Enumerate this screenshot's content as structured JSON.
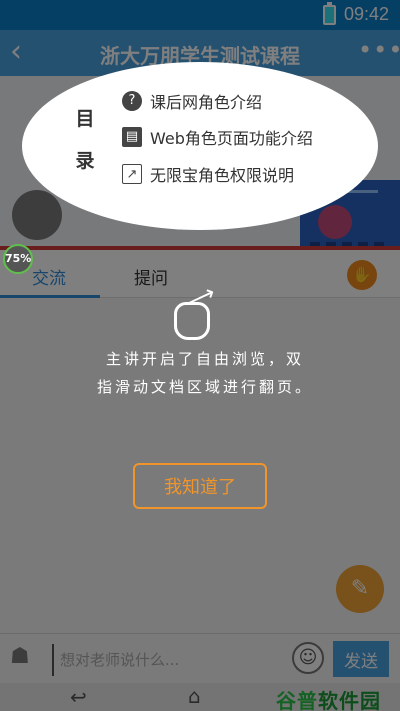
{
  "status_bar": {
    "time": "09:42",
    "battery_icon": "battery-icon"
  },
  "title_bar": {
    "back_icon": "‹",
    "title": "浙大万朋学生测试课程",
    "more_icon": "•••"
  },
  "menu": {
    "heading_line1": "目",
    "heading_line2": "录",
    "items": [
      {
        "icon": "help-circle-icon",
        "glyph": "?",
        "label": "课后网角色介绍"
      },
      {
        "icon": "document-icon",
        "glyph": "▤",
        "label": "Web角色页面功能介绍"
      },
      {
        "icon": "chart-icon",
        "glyph": "↗",
        "label": "无限宝角色权限说明"
      }
    ]
  },
  "progress_badge": "75%",
  "tabs": [
    {
      "label": "交流",
      "active": true
    },
    {
      "label": "提问",
      "active": false
    }
  ],
  "hint": {
    "line1": "主讲开启了自由浏览，双",
    "line2": "指滑动文档区域进行翻页。"
  },
  "got_it_label": "我知道了",
  "input_bar": {
    "placeholder": "想对老师说什么...",
    "send_label": "发送",
    "emoji_glyph": "☺"
  },
  "nav_bar": {
    "back_glyph": "↩",
    "home_glyph": "⌂"
  },
  "watermark": {
    "first": "谷普",
    "rest": "软件园"
  },
  "colors": {
    "primary": "#4aa2e2",
    "accent_orange": "#f0952b",
    "progress_green": "#5fbf4d"
  }
}
